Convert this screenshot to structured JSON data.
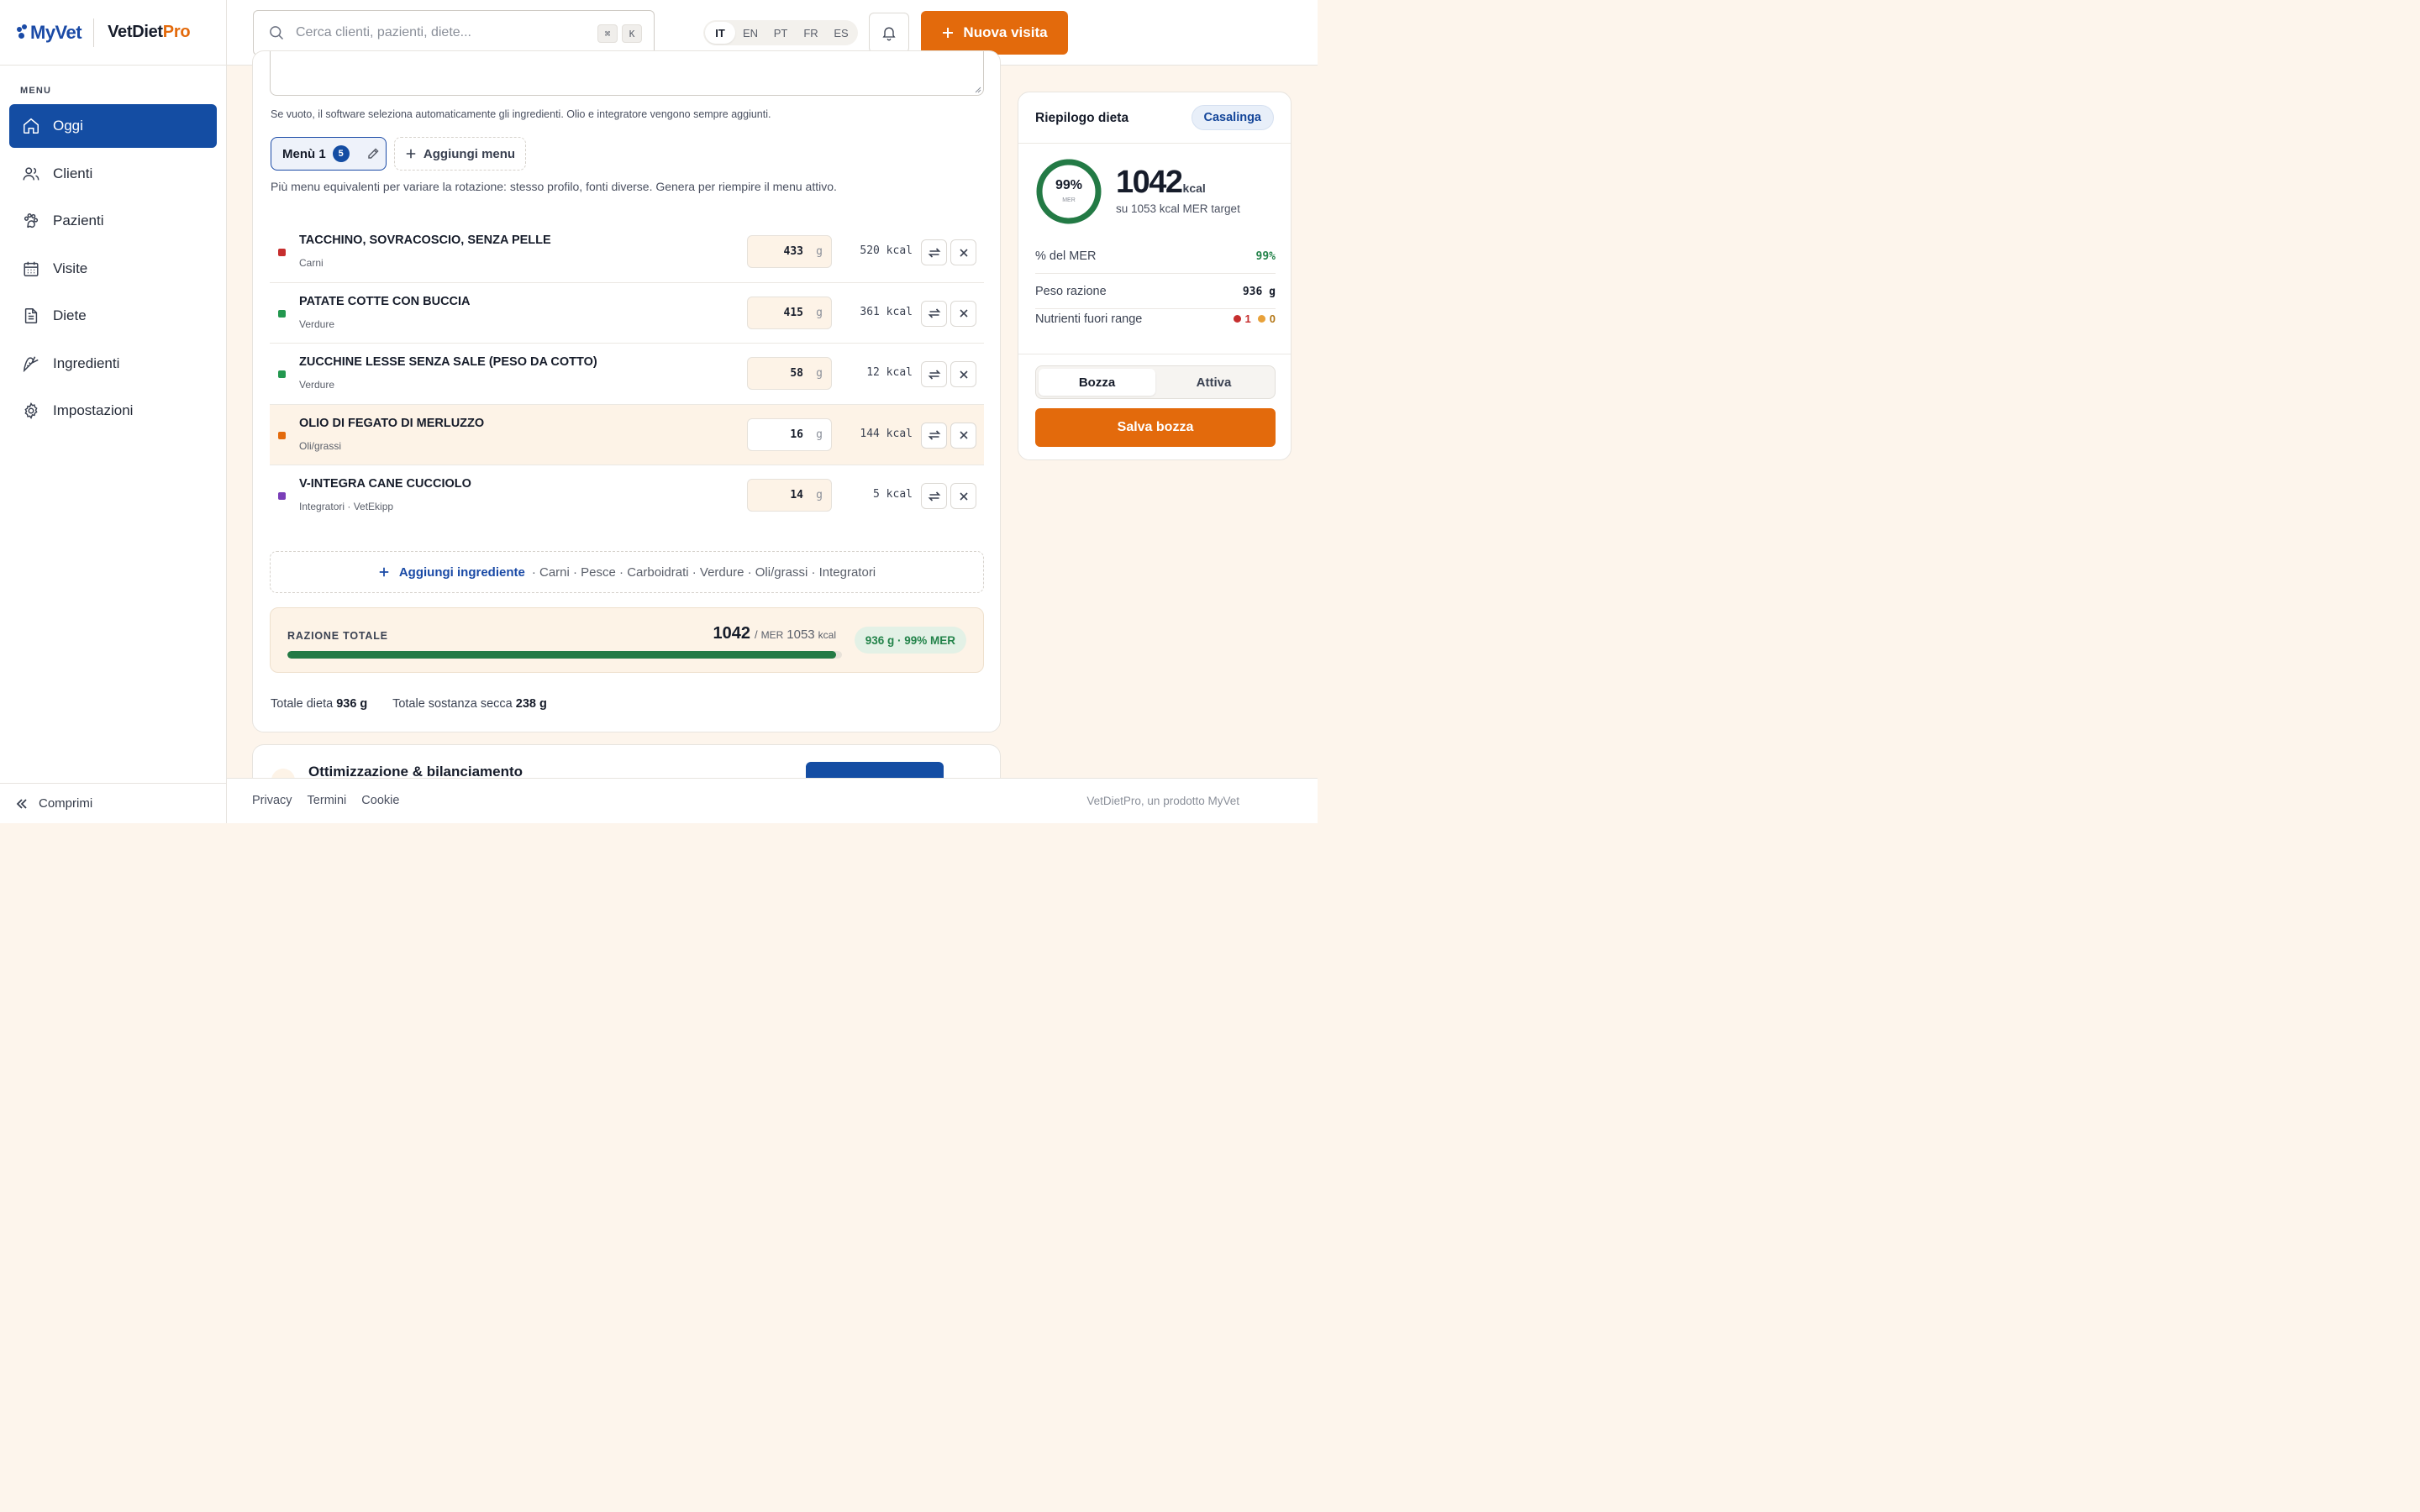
{
  "brand": {
    "logo_text": "MyVet",
    "product_name": "VetDiet",
    "product_suffix": "Pro"
  },
  "sidebar": {
    "menu_label": "MENU",
    "items": [
      {
        "label": "Oggi",
        "icon": "home-icon",
        "active": true
      },
      {
        "label": "Clienti",
        "icon": "users-icon"
      },
      {
        "label": "Pazienti",
        "icon": "paw-icon"
      },
      {
        "label": "Visite",
        "icon": "calendar-icon"
      },
      {
        "label": "Diete",
        "icon": "document-icon"
      },
      {
        "label": "Ingredienti",
        "icon": "carrot-icon"
      },
      {
        "label": "Impostazioni",
        "icon": "gear-icon"
      }
    ],
    "collapse_label": "Comprimi"
  },
  "header": {
    "search_placeholder": "Cerca clienti, pazienti, diete...",
    "shortcut_keys": [
      "⌘",
      "K"
    ],
    "languages": [
      "IT",
      "EN",
      "PT",
      "FR",
      "ES"
    ],
    "active_language": "IT",
    "new_visit_label": "Nuova visita"
  },
  "diet_editor": {
    "auto_hint": "Se vuoto, il software seleziona automaticamente gli ingredienti. Olio e integratore vengono sempre aggiunti.",
    "menu_tab_label": "Menù 1",
    "menu_tab_count": "5",
    "add_menu_label": "Aggiungi menu",
    "menu_hint": "Più menu equivalenti per variare la rotazione: stesso profilo, fonti diverse. Genera per riempire il menu attivo.",
    "ingredients": [
      {
        "name": "TACCHINO, SOVRACOSCIO, SENZA PELLE",
        "category": "Carni",
        "grams": "433",
        "unit": "g",
        "kcal": "520 kcal",
        "color": "#c62e2e"
      },
      {
        "name": "PATATE COTTE CON BUCCIA",
        "category": "Verdure",
        "grams": "415",
        "unit": "g",
        "kcal": "361 kcal",
        "color": "#23984f"
      },
      {
        "name": "ZUCCHINE LESSE SENZA SALE (PESO DA COTTO)",
        "category": "Verdure",
        "grams": "58",
        "unit": "g",
        "kcal": "12 kcal",
        "color": "#23984f"
      },
      {
        "name": "OLIO DI FEGATO DI MERLUZZO",
        "category": "Oli/grassi",
        "grams": "16",
        "unit": "g",
        "kcal": "144 kcal",
        "color": "#e36a0c",
        "highlight": true
      },
      {
        "name": "V-INTEGRA CANE CUCCIOLO",
        "category": "Integratori · VetEkipp",
        "grams": "14",
        "unit": "g",
        "kcal": "5 kcal",
        "color": "#7a3fb8"
      }
    ],
    "add_ingredient_label": "Aggiungi ingrediente",
    "add_ingredient_categories": "· Carni · Pesce · Carboidrati · Verdure · Oli/grassi · Integratori",
    "total": {
      "label": "RAZIONE TOTALE",
      "kcal": "1042",
      "separator": "/",
      "mer_label": "MER",
      "mer_value": "1053",
      "unit": "kcal",
      "pill": "936 g · 99% MER",
      "progress_fraction": 0.99
    },
    "totals_line": {
      "diet_label": "Totale dieta",
      "diet_value": "936 g",
      "dry_label": "Totale sostanza secca",
      "dry_value": "238 g"
    }
  },
  "optimization": {
    "title": "Ottimizzazione & bilanciamento"
  },
  "summary": {
    "title": "Riepilogo dieta",
    "tag": "Casalinga",
    "ring_percent": "99%",
    "ring_label": "MER",
    "ring_fraction": 0.99,
    "kcal": "1042",
    "kcal_unit": "kcal",
    "target_text": "su 1053 kcal MER target",
    "stats": [
      {
        "label": "% del MER",
        "value": "99%"
      },
      {
        "label": "Peso razione",
        "value": "936 g"
      },
      {
        "label": "Nutrienti fuori range",
        "red_count": "1",
        "amber_count": "0"
      }
    ],
    "status_options": [
      "Bozza",
      "Attiva"
    ],
    "active_status": "Bozza",
    "save_label": "Salva bozza"
  },
  "footer": {
    "links": [
      "Privacy",
      "Termini",
      "Cookie"
    ],
    "credit": "VetDietPro, un prodotto MyVet"
  },
  "colors": {
    "primary": "#144da3",
    "accent": "#e36a0c",
    "success": "#23834a",
    "danger": "#c62e2e",
    "warning": "#e8a13a"
  }
}
